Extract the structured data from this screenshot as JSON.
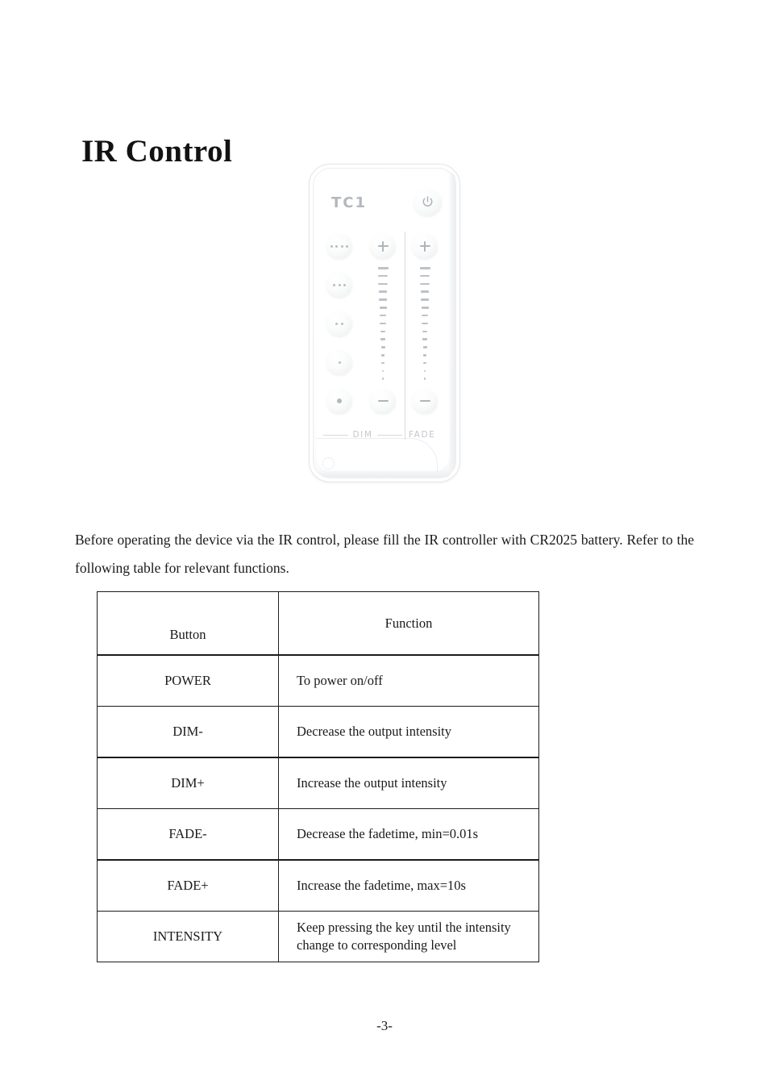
{
  "document": {
    "title": "IR Control",
    "page_number": "-3-",
    "intro_paragraph": "Before operating the device via the IR control, please fill the IR controller with CR2025 battery. Refer to the following table for relevant functions."
  },
  "remote": {
    "brand": "TC1",
    "power_icon": "power-icon",
    "dim_label": "DIM",
    "fade_label": "FADE",
    "plus_glyph": "+",
    "minus_glyph": "−",
    "intensity_buttons": [
      {
        "name": "intensity-level-4",
        "dots": 4
      },
      {
        "name": "intensity-level-3",
        "dots": 3
      },
      {
        "name": "intensity-level-2",
        "dots": 2
      },
      {
        "name": "intensity-level-1",
        "dots": 1
      },
      {
        "name": "intensity-level-off",
        "dots": 1,
        "big": true
      }
    ],
    "scale_ticks": 15,
    "colors": {
      "body": "#ffffff",
      "outline": "#e3e5e7",
      "glyph": "#b3b8bd",
      "tick": "#bdc2c7"
    }
  },
  "table": {
    "headers": [
      "Button",
      "Function"
    ],
    "rows": [
      {
        "button": "POWER",
        "function": "To power on/off"
      },
      {
        "button": "DIM-",
        "function": "Decrease the output intensity"
      },
      {
        "button": "DIM+",
        "function": "Increase the output intensity"
      },
      {
        "button": "FADE-",
        "function": "Decrease the fadetime, min=0.01s"
      },
      {
        "button": "FADE+",
        "function": "Increase the fadetime, max=10s"
      },
      {
        "button": "INTENSITY",
        "function": "Keep pressing the key until the intensity change to corresponding level"
      }
    ]
  }
}
